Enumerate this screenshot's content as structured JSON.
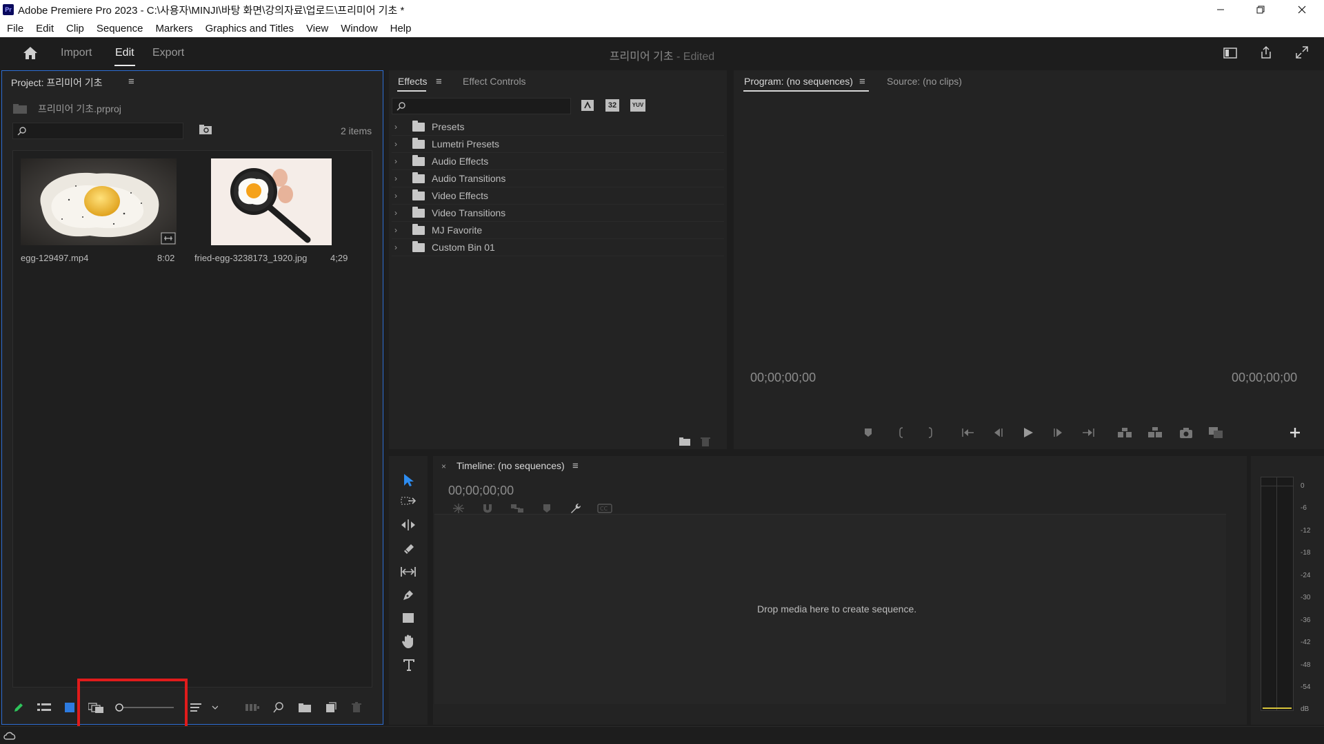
{
  "window": {
    "title": "Adobe Premiere Pro 2023 - C:\\사용자\\MINJI\\바탕 화면\\강의자료\\업로드\\프리미어 기초 *",
    "app_badge": "Pr"
  },
  "menu": [
    "File",
    "Edit",
    "Clip",
    "Sequence",
    "Markers",
    "Graphics and Titles",
    "View",
    "Window",
    "Help"
  ],
  "header": {
    "tabs": [
      "Import",
      "Edit",
      "Export"
    ],
    "active_tab": "Edit",
    "project_title": "프리미어 기초",
    "edited_suffix": " - Edited"
  },
  "project_panel": {
    "title": "Project: 프리미어 기초",
    "file": "프리미어 기초.prproj",
    "item_count": "2 items",
    "items": [
      {
        "name": "egg-129497.mp4",
        "duration": "8:02"
      },
      {
        "name": "fried-egg-3238173_1920.jpg",
        "duration": "4;29"
      }
    ]
  },
  "effects_panel": {
    "tabs": [
      "Effects",
      "Effect Controls"
    ],
    "tree": [
      "Presets",
      "Lumetri Presets",
      "Audio Effects",
      "Audio Transitions",
      "Video Effects",
      "Video Transitions",
      "MJ Favorite",
      "Custom Bin 01"
    ],
    "badge_32": "32",
    "badge_yuv": "YUV"
  },
  "program_panel": {
    "tabs": [
      "Program: (no sequences)",
      "Source: (no clips)"
    ],
    "timecode_left": "00;00;00;00",
    "timecode_right": "00;00;00;00"
  },
  "timeline_panel": {
    "title": "Timeline: (no sequences)",
    "timecode": "00;00;00;00",
    "empty_message": "Drop media here to create sequence."
  },
  "audio_meter": {
    "scale": [
      "0",
      "-6",
      "-12",
      "-18",
      "-24",
      "-30",
      "-36",
      "-42",
      "-48",
      "-54",
      "dB"
    ]
  },
  "colors": {
    "accent_blue": "#2d6fd6",
    "highlight_red": "#e01b1b",
    "panel_bg": "#232323"
  }
}
